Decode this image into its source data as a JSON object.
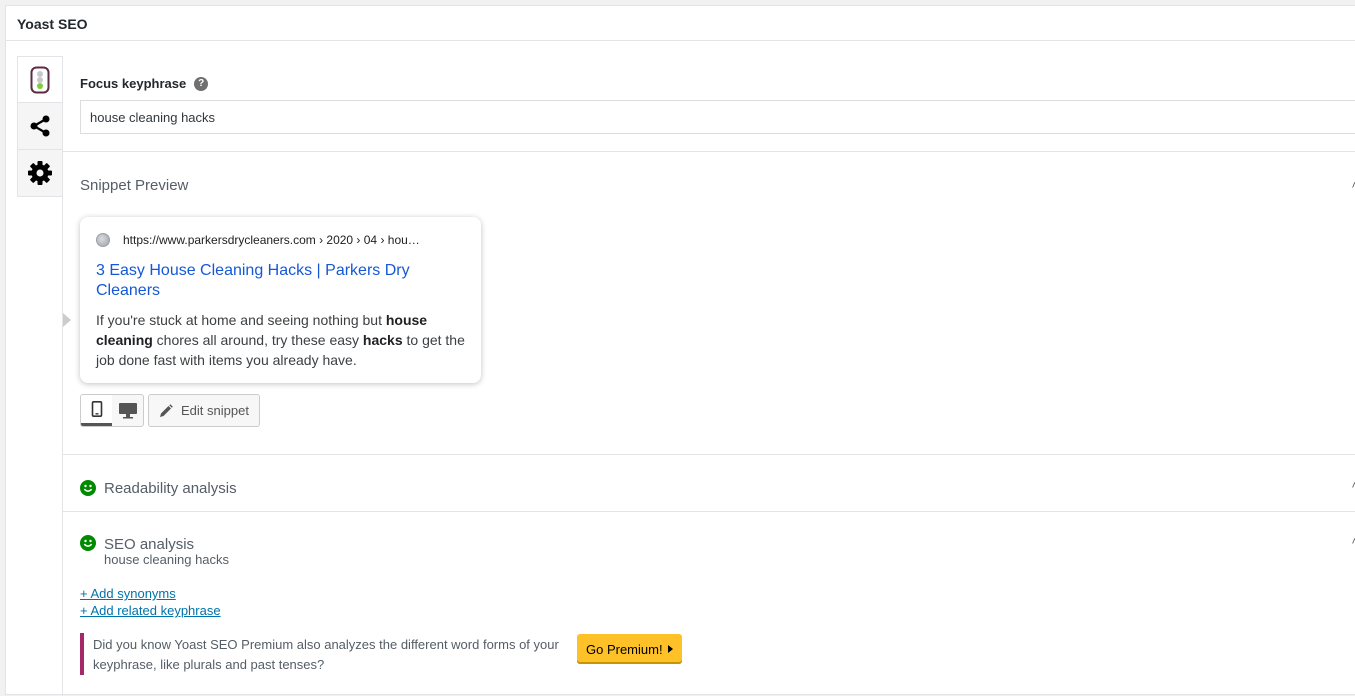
{
  "panel": {
    "title": "Yoast SEO"
  },
  "focus_keyphrase": {
    "label": "Focus keyphrase",
    "help": "?",
    "value": "house cleaning hacks"
  },
  "snippet": {
    "section_title": "Snippet Preview",
    "url": "https://www.parkersdrycleaners.com › 2020 › 04 › hou…",
    "title": "3 Easy House Cleaning Hacks | Parkers Dry Cleaners",
    "description": {
      "p1": "If you're stuck at home and seeing nothing but ",
      "b1": "house cleaning",
      "p2": " chores all around, try these easy ",
      "b2": "hacks",
      "p3": " to get the job done fast with items you already have."
    },
    "edit_label": "Edit snippet",
    "mode": "mobile"
  },
  "readability": {
    "title": "Readability analysis",
    "status": "good"
  },
  "seo": {
    "title": "SEO analysis",
    "keyphrase": "house cleaning hacks",
    "status": "good",
    "add_synonyms": "+ Add synonyms",
    "add_related": "+ Add related keyphrase"
  },
  "premium_notice": {
    "text": "Did you know Yoast SEO Premium also analyzes the different word forms of your keyphrase, like plurals and past tenses?",
    "button": "Go Premium!"
  },
  "colors": {
    "good": "#008a00",
    "link": "#0073aa",
    "premium_border": "#a4286a",
    "premium_button": "#fec228",
    "snippet_title": "#1558d6"
  }
}
